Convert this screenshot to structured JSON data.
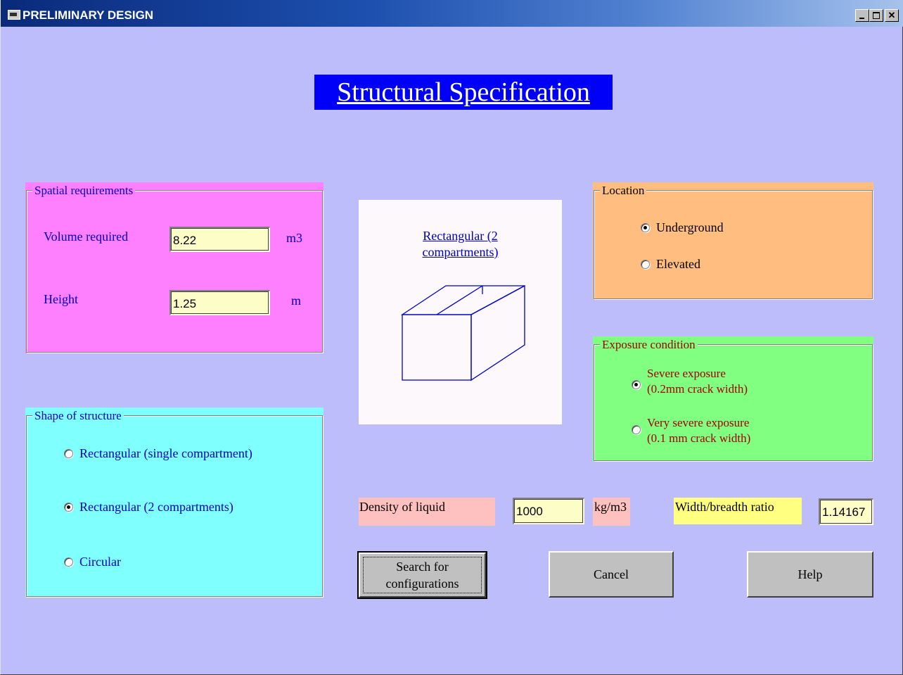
{
  "window": {
    "title": "PRELIMINARY DESIGN",
    "controls": {
      "minimize": "_",
      "maximize": "□",
      "close": "✕"
    }
  },
  "heading": "Structural Specification",
  "spatial": {
    "legend": "Spatial requirements",
    "volume_label": "Volume required",
    "volume_value": "8.22",
    "volume_unit": "m3",
    "height_label": "Height",
    "height_value": "1.25",
    "height_unit": "m"
  },
  "shape": {
    "legend": "Shape of structure",
    "options": [
      {
        "label": "Rectangular (single compartment)",
        "selected": false
      },
      {
        "label": "Rectangular (2 compartments)",
        "selected": true
      },
      {
        "label": "Circular",
        "selected": false
      }
    ]
  },
  "preview": {
    "title_line1": "Rectangular (2",
    "title_line2": "compartments)",
    "icon": "two-compartment-box-drawing"
  },
  "location": {
    "legend": "Location",
    "options": [
      {
        "label": "Underground",
        "selected": true
      },
      {
        "label": "Elevated",
        "selected": false
      }
    ]
  },
  "exposure": {
    "legend": "Exposure condition",
    "options": [
      {
        "line1": "Severe exposure",
        "line2": "(0.2mm crack width)",
        "selected": true
      },
      {
        "line1": "Very severe exposure",
        "line2": "(0.1 mm crack width)",
        "selected": false
      }
    ]
  },
  "density": {
    "label": "Density of liquid",
    "value": "1000",
    "unit": "kg/m3"
  },
  "ratio": {
    "label": "Width/breadth ratio",
    "value": "1.14167"
  },
  "buttons": {
    "search_line1": "Search for",
    "search_line2": "configurations",
    "cancel": "Cancel",
    "help": "Help"
  },
  "colors": {
    "window_bg": "#bdbdfc",
    "spatial_bg": "#ff80ff",
    "shape_bg": "#80ffff",
    "location_bg": "#ffbd80",
    "exposure_bg": "#80ff80",
    "heading_bg": "#0000f8",
    "density_label_bg": "#ffc0c0",
    "ratio_label_bg": "#ffff80",
    "textbox_bg": "#fdfdc8"
  }
}
